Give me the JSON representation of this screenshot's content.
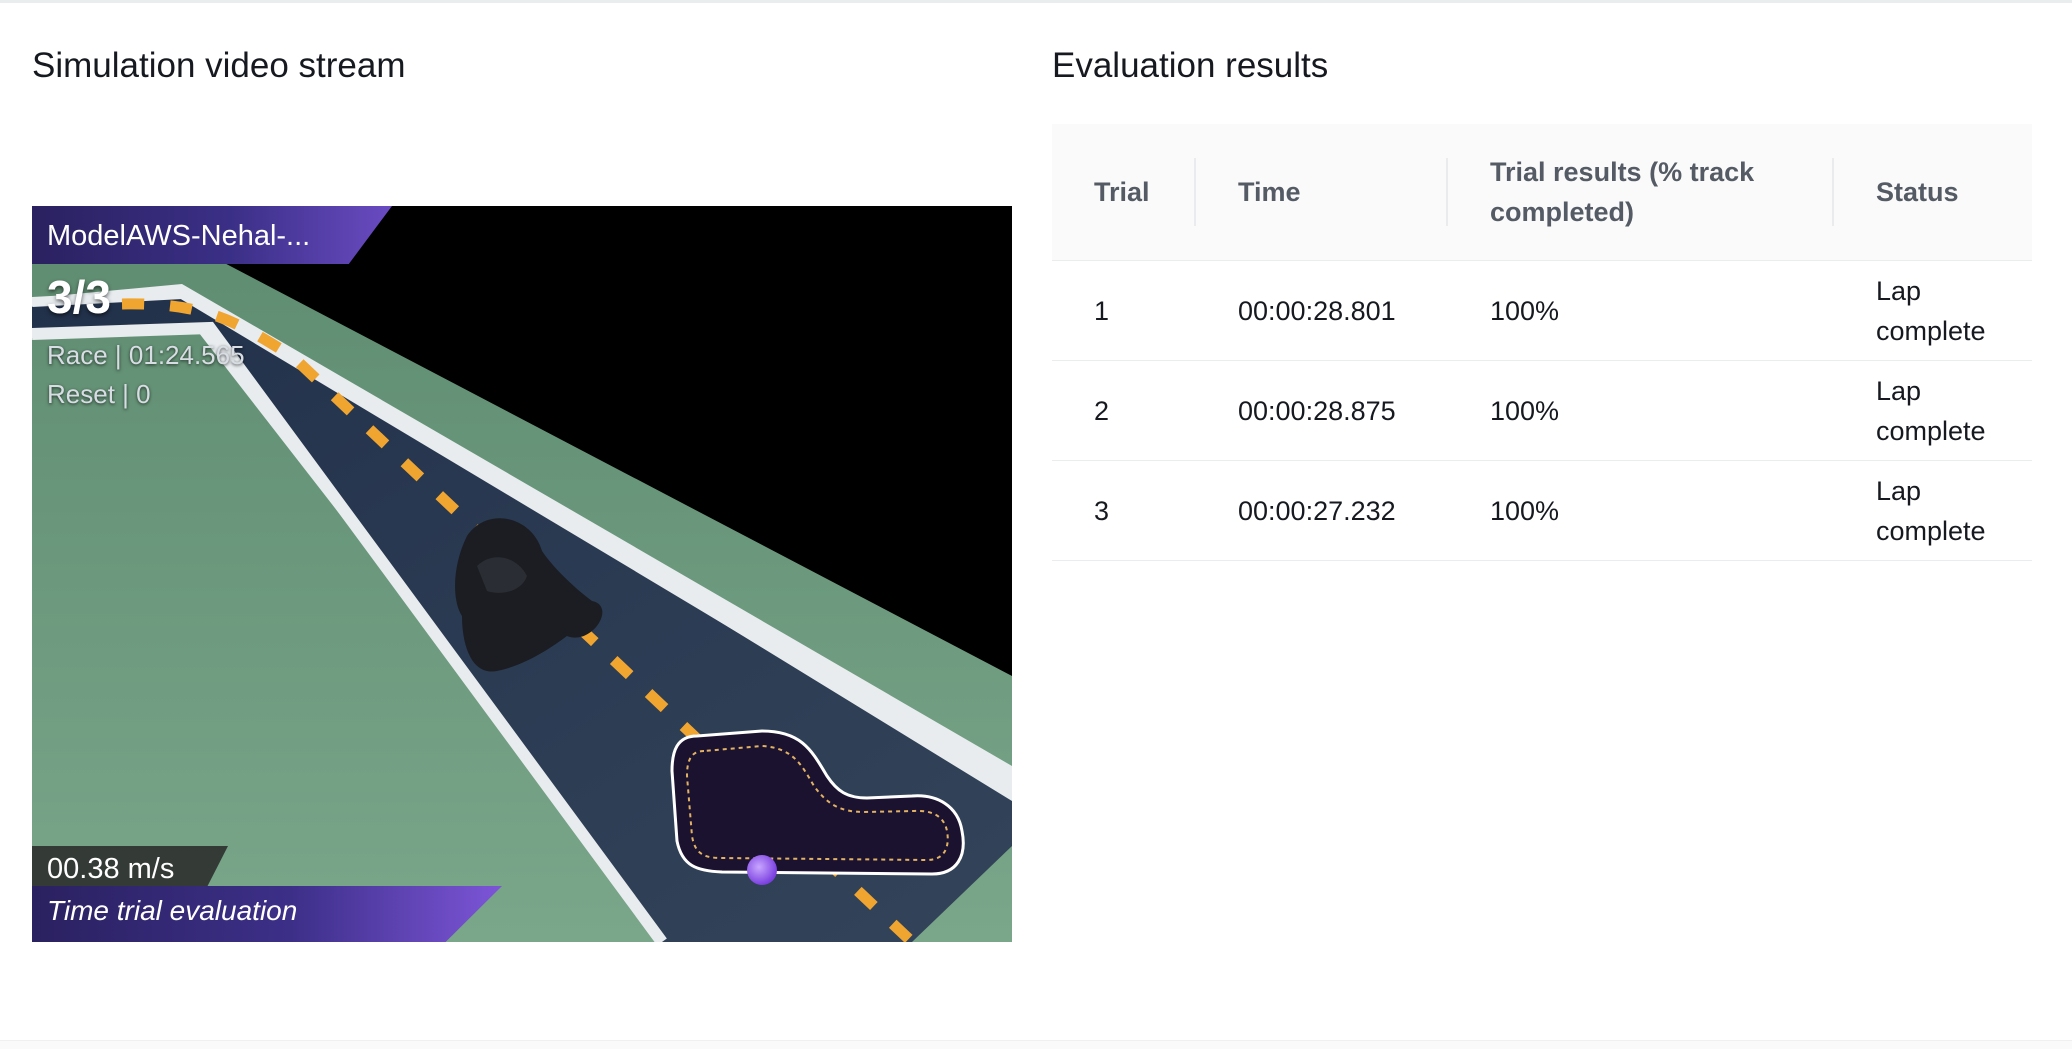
{
  "video_section": {
    "title": "Simulation video stream",
    "hud": {
      "model_name": "ModelAWS-Nehal-...",
      "lap_counter": "3/3",
      "race_time": "Race | 01:24.565",
      "reset_count": "Reset | 0",
      "speed": "00.38 m/s",
      "mode": "Time trial evaluation"
    }
  },
  "results_section": {
    "title": "Evaluation results",
    "columns": [
      "Trial",
      "Time",
      "Trial results (% track completed)",
      "Status"
    ],
    "rows": [
      {
        "trial": "1",
        "time": "00:00:28.801",
        "result": "100%",
        "status": "Lap complete"
      },
      {
        "trial": "2",
        "time": "00:00:28.875",
        "result": "100%",
        "status": "Lap complete"
      },
      {
        "trial": "3",
        "time": "00:00:27.232",
        "result": "100%",
        "status": "Lap complete"
      }
    ]
  },
  "colors": {
    "grass": "#6f9c80",
    "road": "#2b3a4f",
    "center_line": "#f0a531",
    "edge_line": "#e8ecef",
    "hud_purple": "#3a2f86",
    "header_background": "#fafafa",
    "header_text": "#545b64"
  }
}
